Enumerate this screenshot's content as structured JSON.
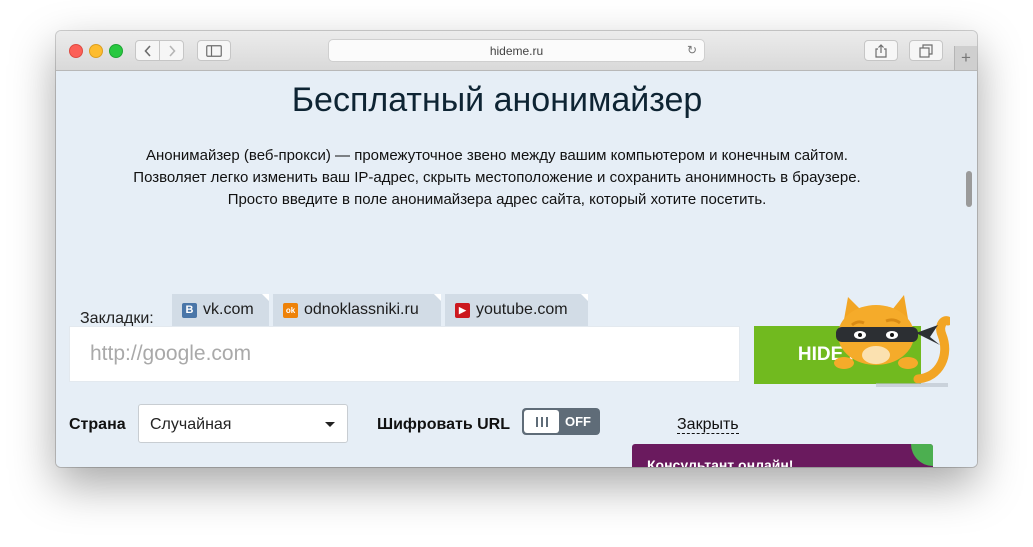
{
  "browser": {
    "url": "hideme.ru",
    "reload_glyph": "↻",
    "new_tab_glyph": "+",
    "icons": {
      "back": "chevron-left-icon",
      "forward": "chevron-right-icon",
      "sidebar": "sidebar-icon",
      "share": "share-icon",
      "tabs": "tabs-icon"
    }
  },
  "page": {
    "title": "Бесплатный анонимайзер",
    "description_lines": [
      "Анонимайзер (веб-прокси) — промежуточное звено между вашим компьютером и конечным сайтом.",
      "Позволяет легко изменить ваш IP-адрес, скрыть местоположение и сохранить анонимность в браузере.",
      "Просто введите в поле анонимайзера адрес сайта, который хотите посетить."
    ],
    "bookmarks": {
      "label": "Закладки:",
      "items": [
        {
          "label": "vk.com",
          "icon_text": "В",
          "color": "#4a76a8"
        },
        {
          "label": "odnoklassniki.ru",
          "icon_text": "ok",
          "color": "#ee8208"
        },
        {
          "label": "youtube.com",
          "icon_text": "▶",
          "color": "#cc181e"
        }
      ]
    },
    "search": {
      "placeholder": "http://google.com",
      "value": ""
    },
    "hide_button": "HIDE ME",
    "country": {
      "label": "Страна",
      "selected": "Случайная"
    },
    "encrypt": {
      "label": "Шифровать URL",
      "state": "OFF"
    },
    "close_link": "Закрыть",
    "consultant": "Консультант онлайн!"
  },
  "colors": {
    "accent_green": "#71ba1f",
    "consultant_purple": "#6a1a5e",
    "page_bg": "#e6eef6",
    "toggle_bg": "#5f6c78"
  }
}
